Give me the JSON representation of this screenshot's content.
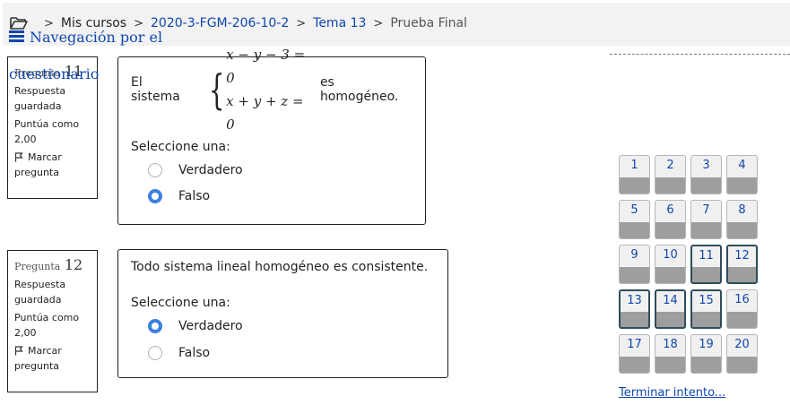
{
  "breadcrumb": {
    "items": [
      "Mis cursos",
      "2020-3-FGM-206-10-2",
      "Tema 13",
      "Prueba Final"
    ],
    "icon": "folder-open-icon"
  },
  "questions": [
    {
      "label": "Pregunta",
      "number": "11",
      "status": "Respuesta guardada",
      "score": "Puntúa como 2,00",
      "flag": "Marcar pregunta",
      "text_before": "El sistema",
      "equations": [
        "x − y − 3 = 0",
        "x + y + z = 0"
      ],
      "text_after": "es homogéneo.",
      "prompt": "Seleccione una:",
      "options": [
        {
          "label": "Verdadero",
          "selected": false
        },
        {
          "label": "Falso",
          "selected": true
        }
      ]
    },
    {
      "label": "Pregunta",
      "number": "12",
      "status": "Respuesta guardada",
      "score": "Puntúa como 2,00",
      "flag": "Marcar pregunta",
      "text": "Todo sistema lineal homogéneo es consistente.",
      "prompt": "Seleccione una:",
      "options": [
        {
          "label": "Verdadero",
          "selected": true
        },
        {
          "label": "Falso",
          "selected": false
        }
      ]
    }
  ],
  "navigation": {
    "title": "Navegación por el cuestionario",
    "icon": "bars-icon",
    "buttons": [
      "1",
      "2",
      "3",
      "4",
      "5",
      "6",
      "7",
      "8",
      "9",
      "10",
      "11",
      "12",
      "13",
      "14",
      "15",
      "16",
      "17",
      "18",
      "19",
      "20"
    ],
    "highlighted": [
      "11",
      "12",
      "13",
      "14",
      "15"
    ],
    "finish_label": "Terminar intento..."
  },
  "colors": {
    "link": "#0f47ad",
    "radio_selected": "#3b7fe0",
    "nav_highlight_border": "#2e4d5c"
  }
}
